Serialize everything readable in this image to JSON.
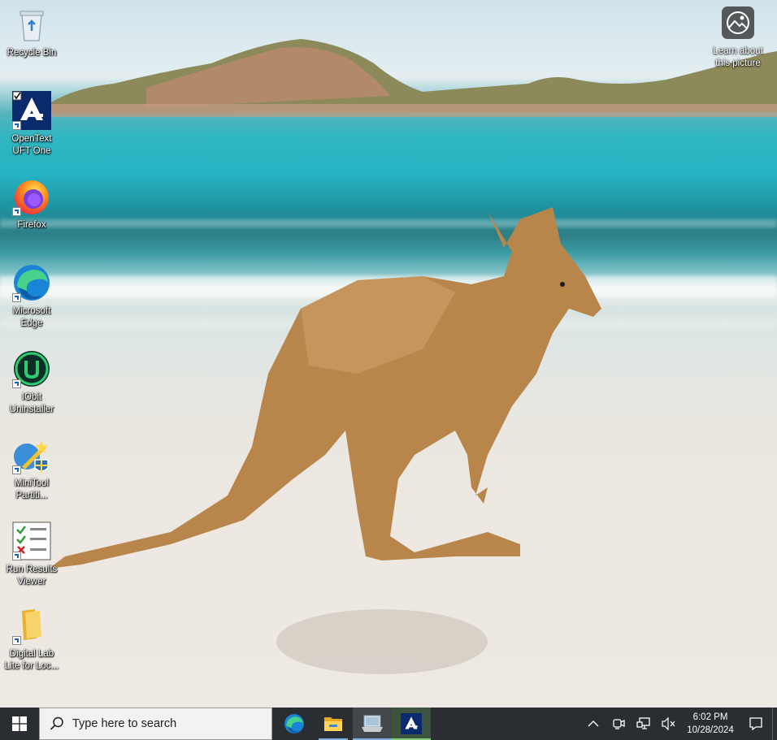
{
  "desktop": {
    "icons": [
      {
        "label": "Recycle Bin",
        "icon": "recycle-bin-icon"
      },
      {
        "label": "OpenText UFT One",
        "icon": "opentext-uft-icon"
      },
      {
        "label": "Firefox",
        "icon": "firefox-icon"
      },
      {
        "label": "Microsoft Edge",
        "icon": "edge-icon"
      },
      {
        "label": "IObit Uninstaller",
        "icon": "iobit-uninstaller-icon"
      },
      {
        "label": "MiniTool Partiti...",
        "icon": "minitool-partition-icon"
      },
      {
        "label": "Run Results Viewer",
        "icon": "run-results-viewer-icon"
      },
      {
        "label": "Digital Lab Lite for Loc...",
        "icon": "folder-icon"
      }
    ],
    "learn_picture": {
      "label": "Learn about this picture",
      "icon": "camera-icon"
    }
  },
  "taskbar": {
    "search_placeholder": "Type here to search",
    "apps": [
      {
        "name": "Microsoft Edge",
        "icon": "edge-icon"
      },
      {
        "name": "File Explorer",
        "icon": "file-explorer-icon"
      },
      {
        "name": "Remote Desktop",
        "icon": "remote-desktop-icon"
      },
      {
        "name": "OpenText UFT One",
        "icon": "opentext-uft-icon"
      }
    ],
    "tray": {
      "icons": [
        "chevron-up-icon",
        "meet-now-icon",
        "network-icon",
        "volume-muted-icon"
      ],
      "time": "6:02 PM",
      "date": "10/28/2024"
    }
  },
  "colors": {
    "taskbar_bg": "#2a2d31",
    "accent": "#7ab3e6",
    "uft_blue": "#0a2a6e"
  }
}
